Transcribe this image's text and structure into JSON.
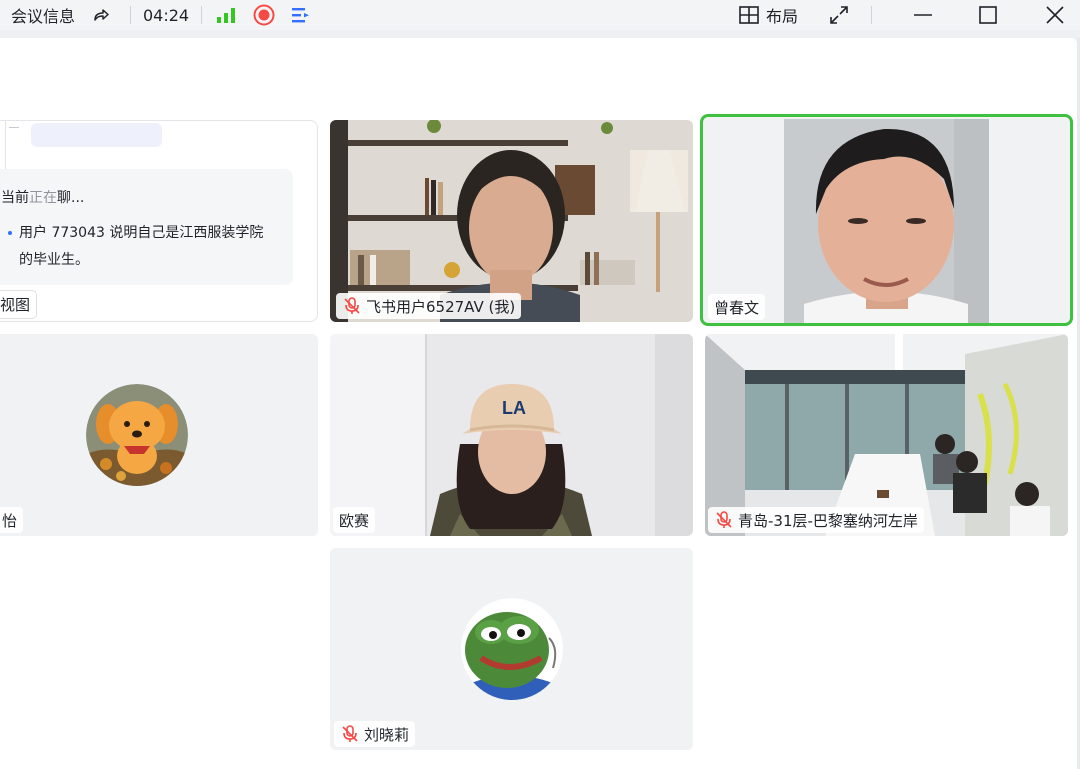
{
  "titlebar": {
    "meeting_info": "会议信息",
    "timer": "04:24",
    "layout_label": "布局"
  },
  "colors": {
    "accent_blue": "#3370ff",
    "signal_green": "#34c724",
    "record_red": "#f54a45",
    "speaking_green": "#3ec13e",
    "mute_red": "#f54a45"
  },
  "summary_panel": {
    "status_prefix": "当前",
    "status_highlight": "正在",
    "status_suffix": "聊...",
    "bullet_text": "用户 773043 说明自己是江西服装学院的毕业生。",
    "view_button_label": "视图"
  },
  "participants": [
    {
      "name": "飞书用户6527AV (我)",
      "muted": true
    },
    {
      "name": "曾春文",
      "muted": false,
      "speaking": true
    },
    {
      "name": "怡",
      "muted": false
    },
    {
      "name": "欧赛",
      "muted": false
    },
    {
      "name": "青岛-31层-巴黎塞纳河左岸",
      "muted": true
    },
    {
      "name": "刘晓莉",
      "muted": true
    }
  ]
}
